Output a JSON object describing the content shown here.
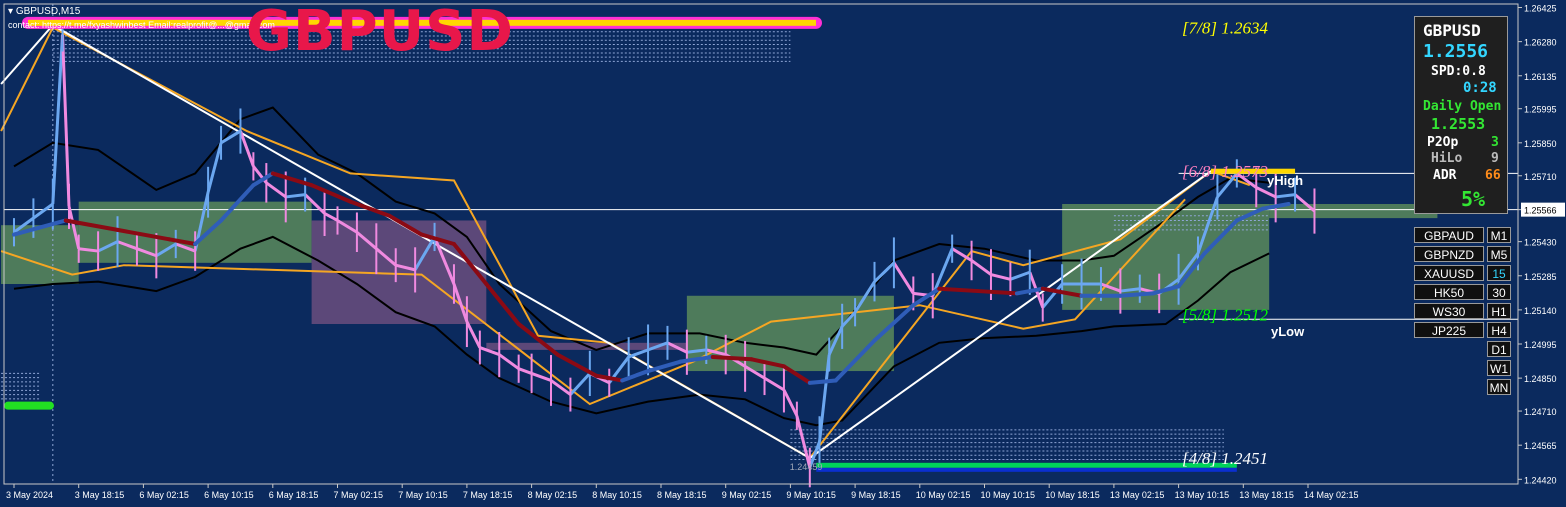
{
  "header": {
    "symbol_timeframe": "GBPUSD,M15",
    "contact": "contact: https://t.me/fxyashwinbest Email:realprofit@...@gmail.com",
    "big_title": "GBPUSD"
  },
  "info_panel": {
    "symbol": "GBPUSD",
    "price": "1.2556",
    "spread": "SPD:0.8",
    "timer": "0:28",
    "daily_open_label": "Daily Open",
    "daily_open_value": "1.2553",
    "p2op_label": "P2Op",
    "p2op_value": "3",
    "hilo_label": "HiLo",
    "hilo_value": "9",
    "adr_label": "ADR",
    "adr_value": "66",
    "percent": "5%"
  },
  "pair_buttons": [
    "GBPAUD",
    "GBPNZD",
    "XAUUSD",
    "HK50",
    "WS30",
    "JP225"
  ],
  "timeframe_buttons": [
    "M1",
    "M5",
    "15",
    "30",
    "H1",
    "H4",
    "D1",
    "W1",
    "MN"
  ],
  "colors": {
    "background": "#0b2a5e",
    "up_candle": "#6ba7f0",
    "down_candle": "#f08ae0",
    "zigzag": "#f5a623",
    "trendline": "#ffffff",
    "ma_up": "#2f5db8",
    "ma_down": "#8b0a14",
    "envelope": "#000000",
    "zone_green": "#5a8a5a",
    "zone_purple": "#6b4d7e",
    "title": "#e8174a"
  },
  "chart_data": {
    "type": "line",
    "symbol": "GBPUSD",
    "timeframe": "M15",
    "current_price": 1.25566,
    "y_ticks": [
      1.26425,
      1.2628,
      1.26135,
      1.25995,
      1.2585,
      1.2571,
      1.25566,
      1.2543,
      1.25285,
      1.2514,
      1.24995,
      1.2485,
      1.2471,
      1.24565,
      1.2442
    ],
    "y_tick_labels": [
      "1.26425",
      "1.26280",
      "1.26135",
      "1.25995",
      "1.25850",
      "1.25710",
      "1.25566",
      "1.25430",
      "1.25285",
      "1.25140",
      "1.24995",
      "1.24850",
      "1.24710",
      "1.24565",
      "1.24420"
    ],
    "ylim": [
      1.244,
      1.2644
    ],
    "x_labels": [
      "3 May 2024",
      "3 May 18:15",
      "6 May 02:15",
      "6 May 10:15",
      "6 May 18:15",
      "7 May 02:15",
      "7 May 10:15",
      "7 May 18:15",
      "8 May 02:15",
      "8 May 10:15",
      "8 May 18:15",
      "9 May 02:15",
      "9 May 10:15",
      "9 May 18:15",
      "10 May 02:15",
      "10 May 10:15",
      "10 May 18:15",
      "13 May 02:15",
      "13 May 10:15",
      "13 May 18:15",
      "14 May 02:15"
    ],
    "x_count": 21,
    "price_series": {
      "name": "GBPUSD M15 close",
      "x": [
        0,
        0.3,
        0.6,
        0.75,
        0.85,
        1.0,
        1.3,
        1.6,
        1.9,
        2.2,
        2.5,
        2.8,
        3.0,
        3.2,
        3.5,
        3.7,
        3.9,
        4.2,
        4.5,
        4.8,
        5.0,
        5.3,
        5.6,
        5.9,
        6.2,
        6.5,
        6.8,
        7.0,
        7.2,
        7.5,
        7.8,
        8.0,
        8.3,
        8.6,
        8.9,
        9.2,
        9.5,
        9.8,
        10.1,
        10.4,
        10.7,
        11.0,
        11.3,
        11.6,
        11.9,
        12.1,
        12.3,
        12.45,
        12.6,
        12.8,
        13.0,
        13.3,
        13.6,
        13.9,
        14.2,
        14.5,
        14.8,
        15.1,
        15.4,
        15.7,
        15.9,
        16.2,
        16.5,
        16.8,
        17.1,
        17.4,
        17.7,
        18.0,
        18.3,
        18.6,
        18.9,
        19.2,
        19.5,
        19.8,
        20.1
      ],
      "y": [
        1.2547,
        1.2553,
        1.2559,
        1.2631,
        1.2558,
        1.254,
        1.2539,
        1.2543,
        1.254,
        1.2537,
        1.2542,
        1.2539,
        1.2564,
        1.2585,
        1.259,
        1.2575,
        1.2568,
        1.2562,
        1.2563,
        1.2555,
        1.2552,
        1.2547,
        1.254,
        1.2533,
        1.2531,
        1.2545,
        1.2525,
        1.2509,
        1.2498,
        1.2495,
        1.2489,
        1.2487,
        1.2484,
        1.2478,
        1.2487,
        1.2483,
        1.2494,
        1.2497,
        1.25,
        1.2496,
        1.2497,
        1.2495,
        1.249,
        1.2485,
        1.248,
        1.2469,
        1.2447,
        1.2458,
        1.2495,
        1.2507,
        1.2513,
        1.2526,
        1.2534,
        1.2521,
        1.252,
        1.254,
        1.2535,
        1.2529,
        1.2527,
        1.253,
        1.2515,
        1.2525,
        1.2525,
        1.2525,
        1.2522,
        1.2523,
        1.2521,
        1.2527,
        1.2538,
        1.2562,
        1.2572,
        1.2566,
        1.2562,
        1.2563,
        1.2556
      ]
    },
    "levels": [
      {
        "label": "[7/8]",
        "value": "1.2634",
        "y": 1.2634,
        "color": "#ffff00"
      },
      {
        "label": "[6/8]",
        "value": "1.2573",
        "y": 1.2573,
        "color": "#ff7fbf"
      },
      {
        "label": "[5/8]",
        "value": "1.2512",
        "y": 1.2512,
        "color": "#00ff00"
      },
      {
        "label": "[4/8]",
        "value": "1.2451",
        "y": 1.2451,
        "color": "#ffffff"
      }
    ],
    "annotations": {
      "y_high": "yHigh",
      "y_low": "yLow",
      "low_price": "1.24459"
    },
    "grid": false,
    "legend": "none"
  }
}
